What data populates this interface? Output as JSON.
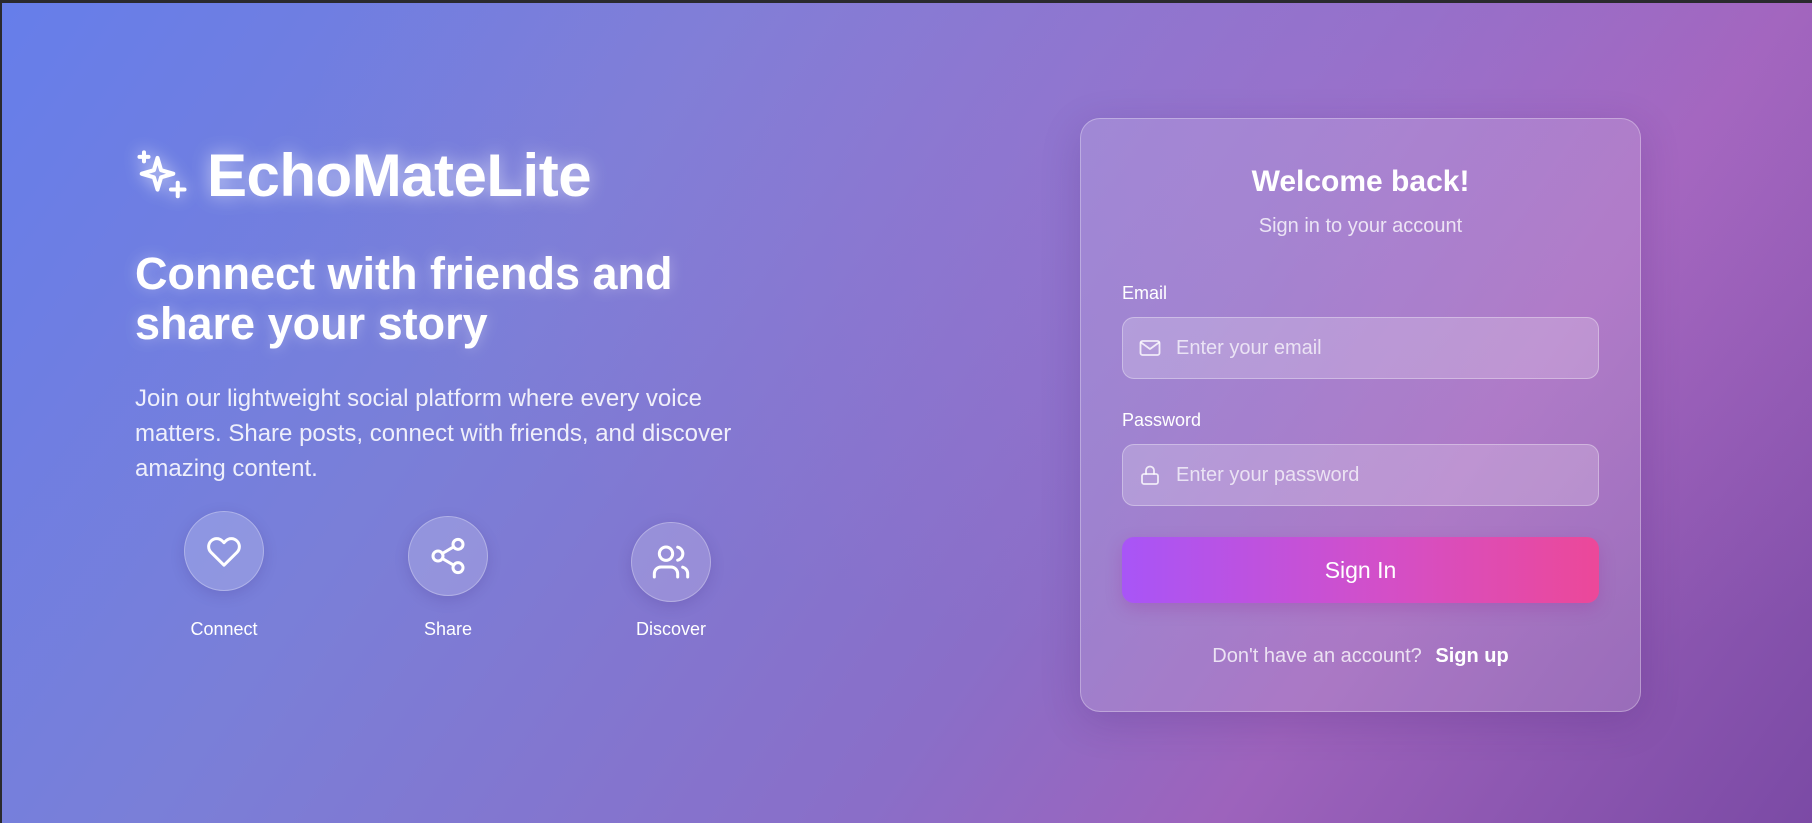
{
  "brand": {
    "name": "EchoMateLite",
    "icon": "sparkles-icon"
  },
  "hero": {
    "tagline": "Connect with friends and share your story",
    "description": "Join our lightweight social platform where every voice matters. Share posts, connect with friends, and discover amazing content."
  },
  "features": [
    {
      "label": "Connect",
      "icon": "heart-icon"
    },
    {
      "label": "Share",
      "icon": "share-icon"
    },
    {
      "label": "Discover",
      "icon": "users-icon"
    }
  ],
  "login": {
    "title": "Welcome back!",
    "subtitle": "Sign in to your account",
    "email": {
      "label": "Email",
      "placeholder": "Enter your email",
      "value": "",
      "icon": "mail-icon"
    },
    "password": {
      "label": "Password",
      "placeholder": "Enter your password",
      "value": "",
      "icon": "lock-icon"
    },
    "submit_label": "Sign In",
    "signup_prompt": "Don't have an account?",
    "signup_link": "Sign up"
  },
  "colors": {
    "background_start": "#667eea",
    "background_end": "#7b4aa5",
    "button_start": "#a855f7",
    "button_end": "#ec4899",
    "text": "#ffffff"
  }
}
